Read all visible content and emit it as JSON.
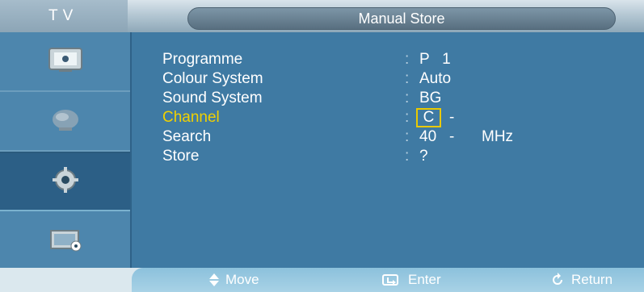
{
  "header": {
    "brand": "TV",
    "title": "Manual Store"
  },
  "sidebar": {
    "items": [
      {
        "name": "picture-menu",
        "icon": "picture-icon",
        "active": false
      },
      {
        "name": "sound-menu",
        "icon": "sound-icon",
        "active": false
      },
      {
        "name": "setup-menu",
        "icon": "gear-icon",
        "active": true
      },
      {
        "name": "input-menu",
        "icon": "input-icon",
        "active": false
      }
    ]
  },
  "menu": {
    "rows": [
      {
        "label": "Programme",
        "value": "P   1"
      },
      {
        "label": "Colour System",
        "value": "Auto"
      },
      {
        "label": "Sound System",
        "value": "BG"
      },
      {
        "label": "Channel",
        "value": "C",
        "extra": "--"
      },
      {
        "label": "Search",
        "value": "40",
        "unit": "MHz"
      },
      {
        "label": "Store",
        "value": "?"
      }
    ]
  },
  "footer": {
    "move": "Move",
    "enter": "Enter",
    "return": "Return"
  },
  "colors": {
    "panel": "#3f7aa3",
    "sidebar": "#4d86ad",
    "highlight": "#f1d100",
    "text": "#ffffff",
    "footer": "#a8d2e6"
  }
}
